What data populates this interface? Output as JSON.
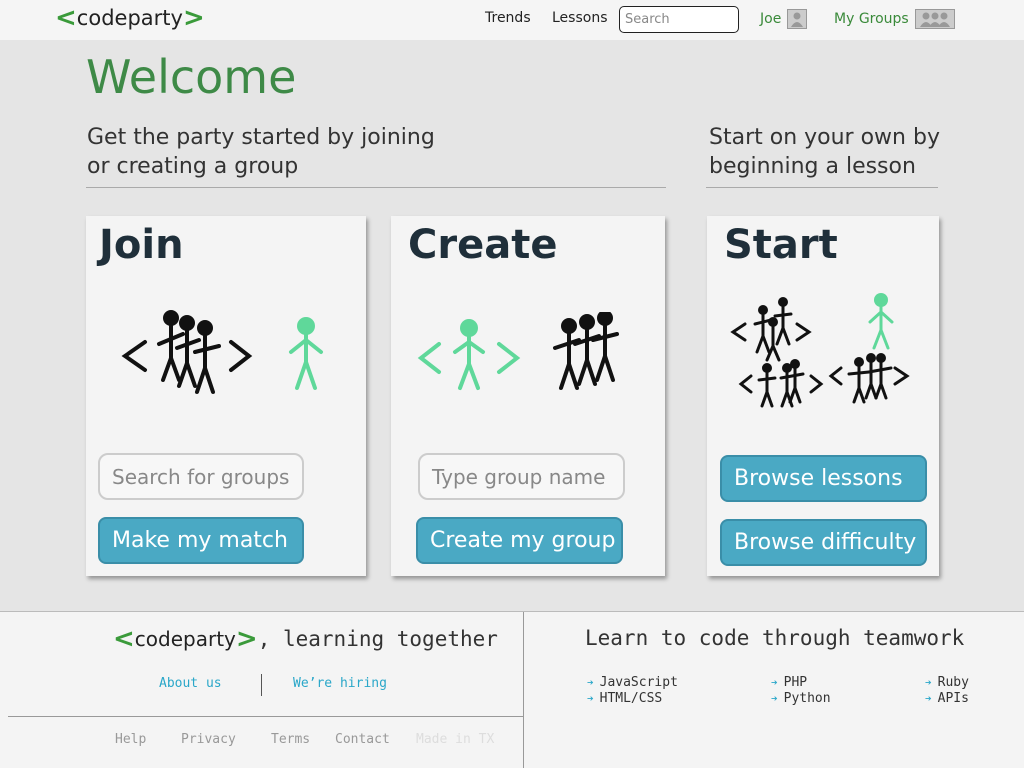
{
  "header": {
    "logo_left": "<",
    "logo_text": "codeparty",
    "logo_right": ">",
    "nav": [
      "Trends",
      "Lessons"
    ],
    "search_placeholder": "Search",
    "user_name": "Joe",
    "groups_label": "My Groups"
  },
  "welcome": {
    "title": "Welcome",
    "group_line1": "Get the party started by joining",
    "group_line2": "or creating a group",
    "solo_line1": "Start on your own by",
    "solo_line2": "beginning a lesson"
  },
  "cards": {
    "join": {
      "title": "Join",
      "input_placeholder": "Search for groups",
      "button": "Make my match"
    },
    "create": {
      "title": "Create",
      "input_placeholder": "Type group name",
      "button": "Create my group"
    },
    "start": {
      "title": "Start",
      "button1": "Browse lessons",
      "button2": "Browse difficulty"
    }
  },
  "footer": {
    "tagline": ", learning together",
    "links": [
      "About us",
      "We’re hiring"
    ],
    "bottom_links": [
      "Help",
      "Privacy",
      "Terms",
      "Contact",
      "Made in TX"
    ],
    "learn_title": "Learn to code through teamwork",
    "languages": [
      "JavaScript",
      "PHP",
      "Ruby",
      "HTML/CSS",
      "Python",
      "APIs"
    ]
  },
  "colors": {
    "accent_green": "#3e8a47",
    "button_blue": "#4aa9c4",
    "figure_green": "#5fd89a",
    "link_blue": "#2aa7c9"
  }
}
